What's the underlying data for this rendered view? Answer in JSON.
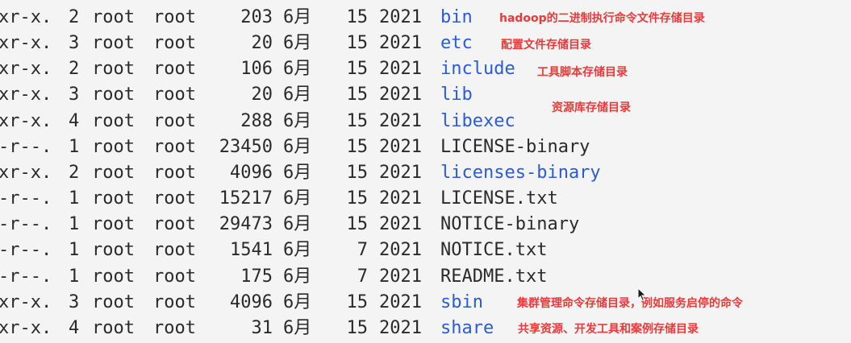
{
  "listing": [
    {
      "perm": "xr-x.",
      "links": "2",
      "owner": "root",
      "group": "root",
      "size": "203",
      "month": "6月",
      "day": "15",
      "year": "2021",
      "name": "bin",
      "type": "dir"
    },
    {
      "perm": "xr-x.",
      "links": "3",
      "owner": "root",
      "group": "root",
      "size": "20",
      "month": "6月",
      "day": "15",
      "year": "2021",
      "name": "etc",
      "type": "dir"
    },
    {
      "perm": "xr-x.",
      "links": "2",
      "owner": "root",
      "group": "root",
      "size": "106",
      "month": "6月",
      "day": "15",
      "year": "2021",
      "name": "include",
      "type": "dir"
    },
    {
      "perm": "xr-x.",
      "links": "3",
      "owner": "root",
      "group": "root",
      "size": "20",
      "month": "6月",
      "day": "15",
      "year": "2021",
      "name": "lib",
      "type": "dir"
    },
    {
      "perm": "xr-x.",
      "links": "4",
      "owner": "root",
      "group": "root",
      "size": "288",
      "month": "6月",
      "day": "15",
      "year": "2021",
      "name": "libexec",
      "type": "dir"
    },
    {
      "perm": "-r--.",
      "links": "1",
      "owner": "root",
      "group": "root",
      "size": "23450",
      "month": "6月",
      "day": "15",
      "year": "2021",
      "name": "LICENSE-binary",
      "type": "file"
    },
    {
      "perm": "xr-x.",
      "links": "2",
      "owner": "root",
      "group": "root",
      "size": "4096",
      "month": "6月",
      "day": "15",
      "year": "2021",
      "name": "licenses-binary",
      "type": "dir"
    },
    {
      "perm": "-r--.",
      "links": "1",
      "owner": "root",
      "group": "root",
      "size": "15217",
      "month": "6月",
      "day": "15",
      "year": "2021",
      "name": "LICENSE.txt",
      "type": "file"
    },
    {
      "perm": "-r--.",
      "links": "1",
      "owner": "root",
      "group": "root",
      "size": "29473",
      "month": "6月",
      "day": "15",
      "year": "2021",
      "name": "NOTICE-binary",
      "type": "file"
    },
    {
      "perm": "-r--.",
      "links": "1",
      "owner": "root",
      "group": "root",
      "size": "1541",
      "month": "6月",
      "day": "7",
      "year": "2021",
      "name": "NOTICE.txt",
      "type": "file"
    },
    {
      "perm": "-r--.",
      "links": "1",
      "owner": "root",
      "group": "root",
      "size": "175",
      "month": "6月",
      "day": "7",
      "year": "2021",
      "name": "README.txt",
      "type": "file"
    },
    {
      "perm": "xr-x.",
      "links": "3",
      "owner": "root",
      "group": "root",
      "size": "4096",
      "month": "6月",
      "day": "15",
      "year": "2021",
      "name": "sbin",
      "type": "dir"
    },
    {
      "perm": "xr-x.",
      "links": "4",
      "owner": "root",
      "group": "root",
      "size": "31",
      "month": "6月",
      "day": "15",
      "year": "2021",
      "name": "share",
      "type": "dir"
    }
  ],
  "annotations": {
    "bin": "hadoop的二进制执行命令文件存储目录",
    "etc": "配置文件存储目录",
    "include": "工具脚本存储目录",
    "lib": "资源库存储目录",
    "sbin": "集群管理命令存储目录，例如服务启停的命令",
    "share": "共享资源、开发工具和案例存储目录"
  },
  "colors": {
    "background": "#f4f4f4",
    "text": "#2a2a2a",
    "directory": "#2a5bd8",
    "annotation": "#e83a3a"
  }
}
